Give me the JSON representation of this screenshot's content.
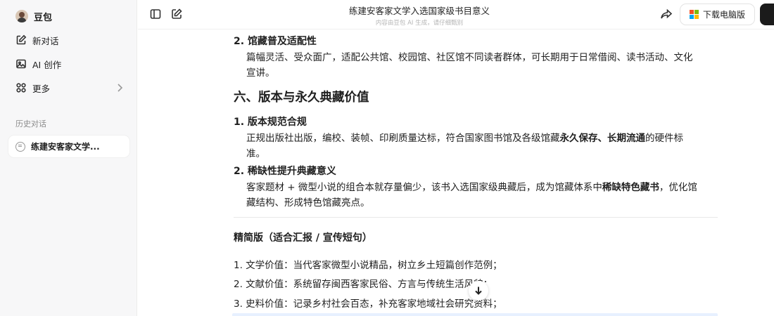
{
  "sidebar": {
    "brand": "豆包",
    "items": [
      {
        "label": "新对话",
        "icon": "new-chat-icon"
      },
      {
        "label": "AI 创作",
        "icon": "image-icon"
      },
      {
        "label": "更多",
        "icon": "grid-icon"
      }
    ],
    "history_label": "历史对话",
    "history_items": [
      {
        "label": "练建安客家文学..."
      }
    ]
  },
  "topbar": {
    "title": "练建安客家文学入选国家级书目意义",
    "subtitle": "内容由豆包 AI 生成，请仔细甄别",
    "download_label": "下载电脑版",
    "ms_colors": [
      "#f25022",
      "#7fba00",
      "#00a4ef",
      "#ffb900"
    ]
  },
  "content": {
    "item2_title": "2. 馆藏普及适配性",
    "item2_line1": "篇幅灵活、受众面广，适配公共馆、校园馆、社区馆不同读者群体，可长期用于日常借阅、读书活动、文化",
    "item2_line2": "宣讲。",
    "section6_title": "六、版本与永久典藏价值",
    "s6_item1_title": "1. 版本规范合规",
    "s6_item1_line1_a": "正规出版社出版，编校、装帧、印刷质量达标，符合国家图书馆及各级馆藏",
    "s6_item1_line1_b": "永久保存、长期流通",
    "s6_item1_line1_c": "的硬件标",
    "s6_item1_line2": "准。",
    "s6_item2_title": "2. 稀缺性提升典藏意义",
    "s6_item2_line1_a": "客家题材 + 微型小说的组合本就存量偏少，该书入选国家级典藏后，成为馆藏体系中",
    "s6_item2_line1_b": "稀缺特色藏书",
    "s6_item2_line1_c": "，优化馆",
    "s6_item2_line2": "藏结构、形成特色馆藏亮点。",
    "brief_title": "精简版（适合汇报 / 宣传短句）",
    "brief_items": [
      "1. 文学价值：当代客家微型小说精品，树立乡土短篇创作范例；",
      "2. 文献价值：系统留存闽西客家民俗、方言与传统生活风貌；",
      "3. 史料价值：记录乡村社会百态，补充客家地域社会研究资料；"
    ]
  }
}
